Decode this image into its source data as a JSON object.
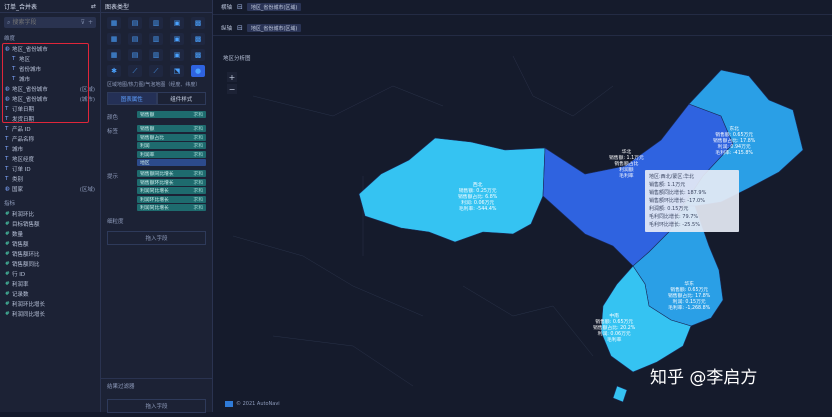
{
  "left": {
    "header": "订单_合并表",
    "search_placeholder": "搜索字段",
    "dimension_label": "维度",
    "dims": [
      {
        "icon": "geo",
        "label": "地区_省份城市",
        "indent": false,
        "tag": ""
      },
      {
        "icon": "T",
        "label": "地区",
        "indent": true,
        "tag": ""
      },
      {
        "icon": "T",
        "label": "省份城市",
        "indent": true,
        "tag": ""
      },
      {
        "icon": "T",
        "label": "城市",
        "indent": true,
        "tag": ""
      },
      {
        "icon": "geo",
        "label": "地区_省份城市",
        "indent": false,
        "tag": "(区域)"
      },
      {
        "icon": "geo",
        "label": "地区_省份城市",
        "indent": false,
        "tag": "(城市)"
      },
      {
        "icon": "T",
        "label": "订单日期",
        "indent": false,
        "tag": ""
      },
      {
        "icon": "T",
        "label": "发货日期",
        "indent": false,
        "tag": ""
      },
      {
        "icon": "T",
        "label": "产品 ID",
        "indent": false,
        "tag": ""
      },
      {
        "icon": "T",
        "label": "产品名称",
        "indent": false,
        "tag": ""
      },
      {
        "icon": "T",
        "label": "城市",
        "indent": false,
        "tag": ""
      },
      {
        "icon": "T",
        "label": "地区经度",
        "indent": false,
        "tag": ""
      },
      {
        "icon": "T",
        "label": "订单 ID",
        "indent": false,
        "tag": ""
      },
      {
        "icon": "T",
        "label": "类别",
        "indent": false,
        "tag": ""
      },
      {
        "icon": "geo",
        "label": "国家",
        "indent": false,
        "tag": "(区域)"
      }
    ],
    "measure_label": "指标",
    "measures": [
      "利润环比",
      "目标销售额",
      "数量",
      "销售额",
      "销售额环比",
      "销售额同比",
      "行 ID",
      "利润率",
      "记录数",
      "利润环比增长",
      "利润同比增长"
    ]
  },
  "mid": {
    "header": "图表类型",
    "chart_icons": [
      "▦",
      "▤",
      "▥",
      "▣",
      "▩",
      "▦",
      "▤",
      "▥",
      "▣",
      "▩",
      "▦",
      "▤",
      "▥",
      "▣",
      "▩",
      "✱",
      "⟋",
      "⟋",
      "⬔",
      "●"
    ],
    "hint": "区域地图/热力图/气泡地图（经度、纬度）",
    "tabs": [
      "图表属性",
      "组件样式"
    ],
    "rows": [
      {
        "label": "颜色",
        "chips": [
          {
            "t": "销售额",
            "s": "求和",
            "c": ""
          }
        ]
      },
      {
        "label": "标签",
        "chips": [
          {
            "t": "销售额",
            "s": "求和",
            "c": ""
          },
          {
            "t": "销售额占比",
            "s": "求和",
            "c": ""
          },
          {
            "t": "利润",
            "s": "求和",
            "c": ""
          },
          {
            "t": "利润率",
            "s": "求和",
            "c": ""
          },
          {
            "t": "地区",
            "s": "",
            "c": "blue"
          }
        ]
      },
      {
        "label": "提示",
        "chips": [
          {
            "t": "销售额同比增长",
            "s": "求和",
            "c": ""
          },
          {
            "t": "销售额环比增长",
            "s": "求和",
            "c": ""
          },
          {
            "t": "利润同比增长",
            "s": "求和",
            "c": ""
          },
          {
            "t": "利润环比增长",
            "s": "求和",
            "c": ""
          },
          {
            "t": "利润同比增长",
            "s": "求和",
            "c": ""
          }
        ]
      },
      {
        "label": "细粒度",
        "chips": []
      }
    ],
    "gran_btn": "拖入字段",
    "filter_label": "结果过滤器",
    "filter_btn": "拖入字段"
  },
  "main": {
    "bar1_k": "横轴",
    "bar1_v": "地区_省份城市(区域)",
    "bar2_k": "纵轴",
    "bar2_v": "地区_省份城市(区域)",
    "title": "地区分析图",
    "tooltip": [
      "地区:西北/蒙区:华北",
      "销售额: 1.1万元",
      "销售额同比增长: 187.9%",
      "销售额环比增长: -17.0%",
      "利润额: 0.15万元",
      "毛利同比增长: 79.7%",
      "毛利环比增长: -25.5%"
    ],
    "regions": [
      {
        "lines": [
          "东北",
          "销售额: 0.65万元",
          "销售额占比: 17.8%",
          "利润: 0.94万元",
          "毛利率: -415.8%"
        ]
      },
      {
        "lines": [
          "华北",
          "销售额: 1.1万元",
          "销售额占比",
          "利润额",
          "毛利率"
        ]
      },
      {
        "lines": [
          "西北",
          "销售额: 0.25万元",
          "销售额占比: 6.8%",
          "利润: 0.06万元",
          "毛利率: -544.4%"
        ]
      },
      {
        "lines": [
          "华东",
          "销售额: 0.65万元",
          "销售额占比: 17.8%",
          "利润: 0.15万元",
          "毛利率: -1,268.8%"
        ]
      },
      {
        "lines": [
          "中南",
          "销售额: 0.65万元",
          "销售额占比: 20.2%",
          "利润: 0.06万元",
          "毛利率"
        ]
      }
    ],
    "watermark": "知乎 @李启方",
    "footer": "© 2021 AutoNavi"
  },
  "colors": {
    "light": "#35c3f2",
    "mid": "#2a9fe6",
    "dark": "#2f63e0",
    "tooltip_bg": "#e6eaf5",
    "highlight": "#e0263a"
  }
}
